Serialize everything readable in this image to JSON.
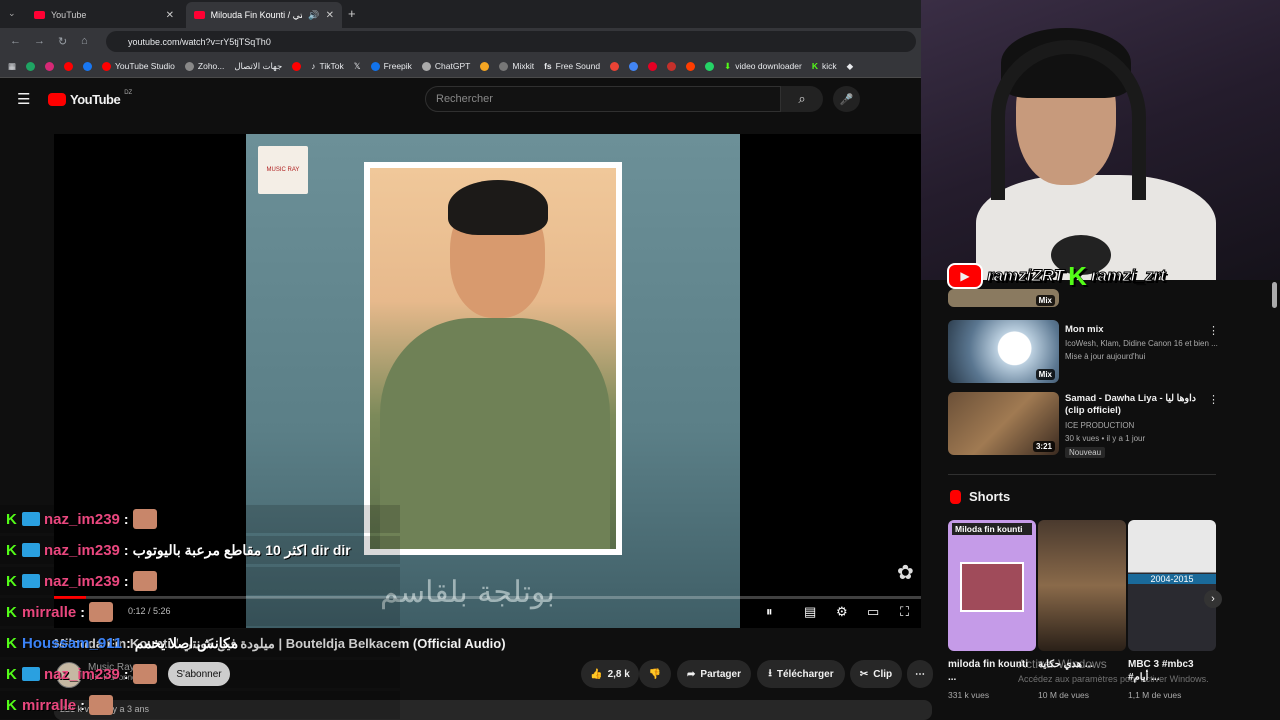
{
  "browser": {
    "tabs": [
      {
        "label": "YouTube"
      },
      {
        "label": "Milouda Fin Kounti / ميلودة فين كونتي"
      }
    ],
    "url": "youtube.com/watch?v=rY5tjTSqTh0",
    "bookmarks": [
      "YouTube Studio",
      "Zoho...",
      "جهات الاتصال",
      "TikTok",
      "Freepik",
      "ChatGPT",
      "Mixkit",
      "Free Sound",
      "video downloader",
      "kick"
    ]
  },
  "youtube": {
    "logo": "YouTube",
    "region": "DZ",
    "search_placeholder": "Rechercher"
  },
  "player": {
    "current_time": "0:12 / 5:26",
    "progress": 0.037,
    "video_title": "Milouda Fin Kounti / ميلودة فين كونتي | Bouteldja Belkacem (Official Audio)",
    "art_logo_text": "MUSIC RAY",
    "art_caption": "بوتلجة بلقاسم"
  },
  "channel": {
    "name": "Music Ray",
    "subscribers": "186 k abonnés",
    "subscribe_label": "S'abonner"
  },
  "actions": {
    "likes": "2,8 k",
    "share": "Partager",
    "download": "Télécharger",
    "clip": "Clip"
  },
  "description": {
    "meta": "221 k vues il y a 3 ans"
  },
  "chat": [
    {
      "user": "naz_im239",
      "text": "",
      "emote": true
    },
    {
      "user": "naz_im239",
      "text": "اكثر 10 مقاطع مرعبة باليوتوب dir dir",
      "emote": false
    },
    {
      "user": "naz_im239",
      "text": "",
      "emote": true
    },
    {
      "user": "mirralle",
      "text": "",
      "emote": true
    },
    {
      "user": "Houssam_911",
      "text": "مكانش اصلا يخمم",
      "emote": false
    },
    {
      "user": "naz_im239",
      "text": "",
      "emote": true
    },
    {
      "user": "mirralle",
      "text": "",
      "emote": true
    }
  ],
  "overlay": {
    "youtube_handle": "ramziZRT",
    "kick_handle": "ramzi_zrt"
  },
  "recommendations": [
    {
      "title": "Mon mix",
      "sub1": "IcoWesh, Klam, Didine Canon 16 et bien ...",
      "sub2": "Mise à jour aujourd'hui",
      "badge": "Mix",
      "new": ""
    },
    {
      "title": "Samad - Dawha Liya - داوها ليا (clip officiel)",
      "sub1": "ICE PRODUCTION",
      "sub2": "30 k vues • il y a 1 jour",
      "badge": "3:21",
      "new": "Nouveau"
    }
  ],
  "top_badge": "Mix",
  "shorts": {
    "title": "Shorts",
    "items": [
      {
        "title": "miloda fin kounti ...",
        "views": "331 k vues",
        "thumb_text": "Miloda fin kounti"
      },
      {
        "title": "هدي حكاية ...",
        "views": "10 M de vues",
        "thumb_text": ""
      },
      {
        "title": "MBC 3 #mbc3 #أيام ...",
        "views": "1,1 M de vues",
        "thumb_text": "2004-2015"
      }
    ]
  },
  "windows_watermark": {
    "line1": "Activer Windows",
    "line2": "Accédez aux paramètres pour activer Windows."
  },
  "colors": {
    "accent": "#ff0000",
    "kick": "#53fc18",
    "chat_name": "#e9477e"
  }
}
